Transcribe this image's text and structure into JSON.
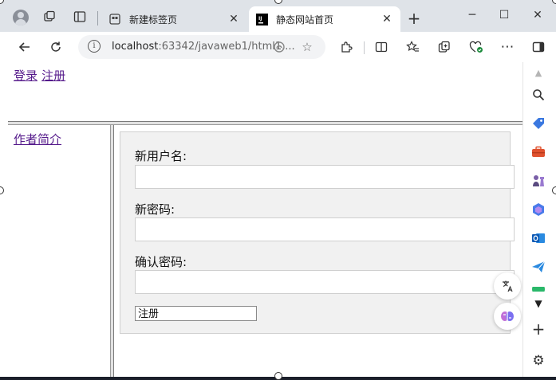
{
  "browser": {
    "tabs": [
      {
        "title": "新建标签页",
        "active": false
      },
      {
        "title": "静态网站首页",
        "active": true
      }
    ],
    "address": {
      "host": "localhost",
      "rest": ":63342/javaweb1/html1...."
    },
    "colors": {
      "titlebar": "#dfe3e8",
      "toolbar": "#ffffff",
      "link_visited": "#551a8b"
    }
  },
  "page": {
    "top_links": {
      "login": "登录",
      "register": "注册"
    },
    "left_links": {
      "author": "作者简介"
    },
    "form": {
      "username_label": "新用户名:",
      "password_label": "新密码:",
      "confirm_label": "确认密码:",
      "submit_value": "注册"
    }
  },
  "sidebar_icons": [
    "search-icon",
    "tag-icon",
    "toolbox-icon",
    "chess-icon",
    "copilot-icon",
    "outlook-icon",
    "send-icon",
    "chevron-down-icon",
    "add-icon",
    "settings-icon"
  ]
}
